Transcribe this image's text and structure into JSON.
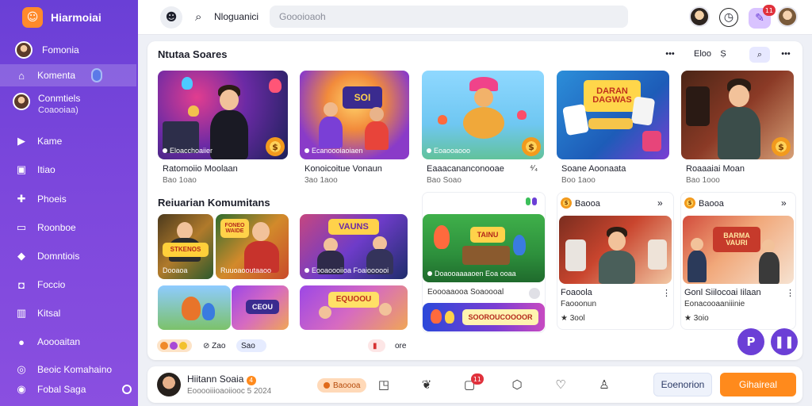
{
  "app": {
    "name": "Hiarmoiai",
    "logo_glyph": "☺",
    "accent": "#6b3fd6",
    "cta": "#ff8a1c"
  },
  "sidebar": {
    "items": [
      {
        "label": "Fomonia",
        "icon": "avatar-icon"
      },
      {
        "label": "Komenta",
        "icon": "home-icon"
      },
      {
        "label": "Conmtiels",
        "sub": "Coaooiaa)",
        "icon": "profile-avatar"
      },
      {
        "label": "Kame",
        "icon": "play-icon"
      },
      {
        "label": "Itiao",
        "icon": "controller-icon"
      },
      {
        "label": "Phoeis",
        "icon": "puzzle-icon"
      },
      {
        "label": "Roonboe",
        "icon": "window-icon"
      },
      {
        "label": "Domntiois",
        "icon": "gem-icon"
      },
      {
        "label": "Foccio",
        "icon": "chat-icon"
      },
      {
        "label": "Kitsal",
        "icon": "chart-icon"
      },
      {
        "label": "Aoooaitan",
        "icon": "globe-icon"
      },
      {
        "label": "Beoic Komahaino",
        "icon": "settings-icon"
      },
      {
        "label": "Fobal Saga",
        "icon": "user-icon"
      }
    ]
  },
  "topbar": {
    "title": "Nloguanici",
    "search_placeholder": "Goooioaoh",
    "notification_count": "11"
  },
  "main": {
    "section1_title": "Ntutaa Soares",
    "header_controls": {
      "more": "•••",
      "filter": "Eloo",
      "sort": "Ṣ"
    },
    "featured": [
      {
        "title": "Ratomoiio Moolaan",
        "sub": "Bao 1oao",
        "tag": "Eloacchoaiier",
        "coin": "$"
      },
      {
        "title": "Konoicoitue Vonaun",
        "sub": "3ao 1aoo",
        "tag": "Ecanoooiaoiaen",
        "coin": ""
      },
      {
        "title": "Eaaacananconooae",
        "sub": "Bao Soao",
        "tag": "Eoaooaooo",
        "coin": "$",
        "more": "⁴⁄₄"
      },
      {
        "title": "Soane Aoonaata",
        "sub": "Boo 1aoo",
        "tag": "",
        "coin": "",
        "sign": "DARAN DAGWAS"
      },
      {
        "title": "Roaaaiai Moan",
        "sub": "Bao 1ooo",
        "tag": "",
        "coin": "$"
      }
    ],
    "section2_title": "Reiuarian Komumitans",
    "community": [
      {
        "sign": "STKENOS",
        "sub_tag": "Dooaoa",
        "detail": "Ruuoaooutaaoo",
        "sign2": "FONEO WAIDE"
      },
      {
        "sign": "VAUNS",
        "tag": "Eooaoooiioa Foaioooooi"
      },
      {
        "sign": "CEOU"
      },
      {
        "sign": "EQUOOU"
      }
    ],
    "chips": {
      "a": "Zao",
      "b": "Sao",
      "c": "ore"
    },
    "board": {
      "tag": "Doaooaaaaoen Eoa ooaa",
      "sign": "TAINU",
      "line": "Eoooaaooa Soaoooal",
      "banner": "SOOROUCOOOOR"
    },
    "right_panel_1": {
      "label": "Baooa",
      "title": "Foaoola",
      "sub": "Faooonun",
      "rating": "3ool"
    },
    "right_panel_2": {
      "label": "Baooa",
      "title": "Gonl Siilocoai Iilaan",
      "sub": "Eonacooaaniiinie",
      "rating": "3oio",
      "sign": "BARMA VAURI"
    }
  },
  "bottombar": {
    "name": "Hiitann Soaia",
    "name_badge": "4",
    "sub": "Eooooiiioaoiiooc 5 2024",
    "chip": "Baoooa",
    "icons_badge": "11",
    "secondary": "Eoenorion",
    "primary": "Gihaireal"
  }
}
